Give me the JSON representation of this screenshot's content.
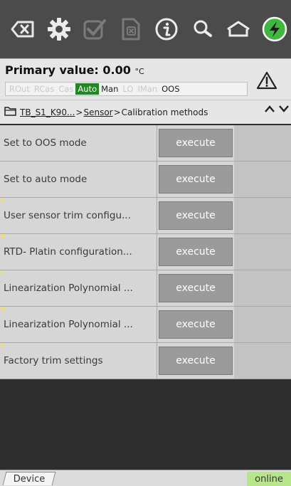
{
  "toolbar": {
    "icons": [
      "backspace-icon",
      "gear-icon",
      "check-icon",
      "cancel-icon",
      "info-icon",
      "search-icon",
      "home-icon",
      "power-icon"
    ]
  },
  "header": {
    "primary_label": "Primary value:",
    "primary_value": "0.00",
    "primary_unit": "°C",
    "modes": [
      {
        "label": "ROut",
        "state": "disabled"
      },
      {
        "label": "RCas",
        "state": "disabled"
      },
      {
        "label": "Cas",
        "state": "disabled"
      },
      {
        "label": "Auto",
        "state": "active"
      },
      {
        "label": "Man",
        "state": "enabled"
      },
      {
        "label": "LO",
        "state": "disabled"
      },
      {
        "label": "IMan",
        "state": "disabled"
      },
      {
        "label": "OOS",
        "state": "enabled"
      }
    ]
  },
  "breadcrumb": {
    "root": "TB_S1_K90...",
    "sep1": ">",
    "middle": "Sensor",
    "sep2": ">",
    "last": "Calibration methods"
  },
  "methods": [
    {
      "label": "Set to OOS mode",
      "button": "execute",
      "flag": false
    },
    {
      "label": "Set to auto mode",
      "button": "execute",
      "flag": false
    },
    {
      "label": "User sensor trim configu...",
      "button": "execute",
      "flag": true
    },
    {
      "label": "RTD- Platin configuration...",
      "button": "execute",
      "flag": true
    },
    {
      "label": "Linearization Polynomial ...",
      "button": "execute",
      "flag": true
    },
    {
      "label": "Linearization Polynomial ...",
      "button": "execute",
      "flag": true
    },
    {
      "label": "Factory trim settings",
      "button": "execute",
      "flag": true
    }
  ],
  "status": {
    "tab": "Device",
    "connection": "online"
  },
  "colors": {
    "mode_active": "#1c8a1c",
    "online": "#b7e58a",
    "power": "#3fb83f"
  }
}
